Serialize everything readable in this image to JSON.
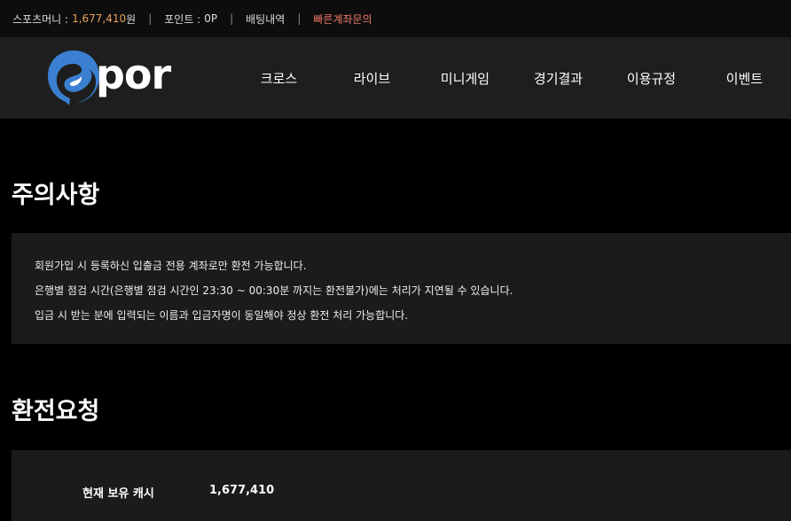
{
  "topbar": {
    "money_label": "스포츠머니 :",
    "money_value": "1,677,410",
    "money_unit": "원",
    "point_label": "포인트 :",
    "point_value": "0P",
    "betting_history": "배팅내역",
    "quick_account": "빠른계좌문의"
  },
  "logo": {
    "wordmark": "por"
  },
  "nav": {
    "items": [
      "크로스",
      "라이브",
      "미니게임",
      "경기결과",
      "이용규정",
      "이벤트"
    ]
  },
  "notice": {
    "title": "주의사항",
    "lines": [
      "회원가입 시 등록하신 입출금 전용 계좌로만 환전 가능합니다.",
      "은행별 점검 시간(은행별 점검 시간인 23:30 ~ 00:30분 까지는 환전불가)에는 처리가 지연될 수 있습니다.",
      "입금 시 받는 분에 입력되는 이름과 입금자명이 동일해야 정상 환전 처리 가능합니다."
    ]
  },
  "request": {
    "title": "환전요청",
    "cash_label": "현재 보유 캐시",
    "cash_value": "1,677,410"
  },
  "colors": {
    "money": "#e8a35c",
    "quick": "#f07a6a",
    "logo_blue": "#3a7fd0"
  }
}
